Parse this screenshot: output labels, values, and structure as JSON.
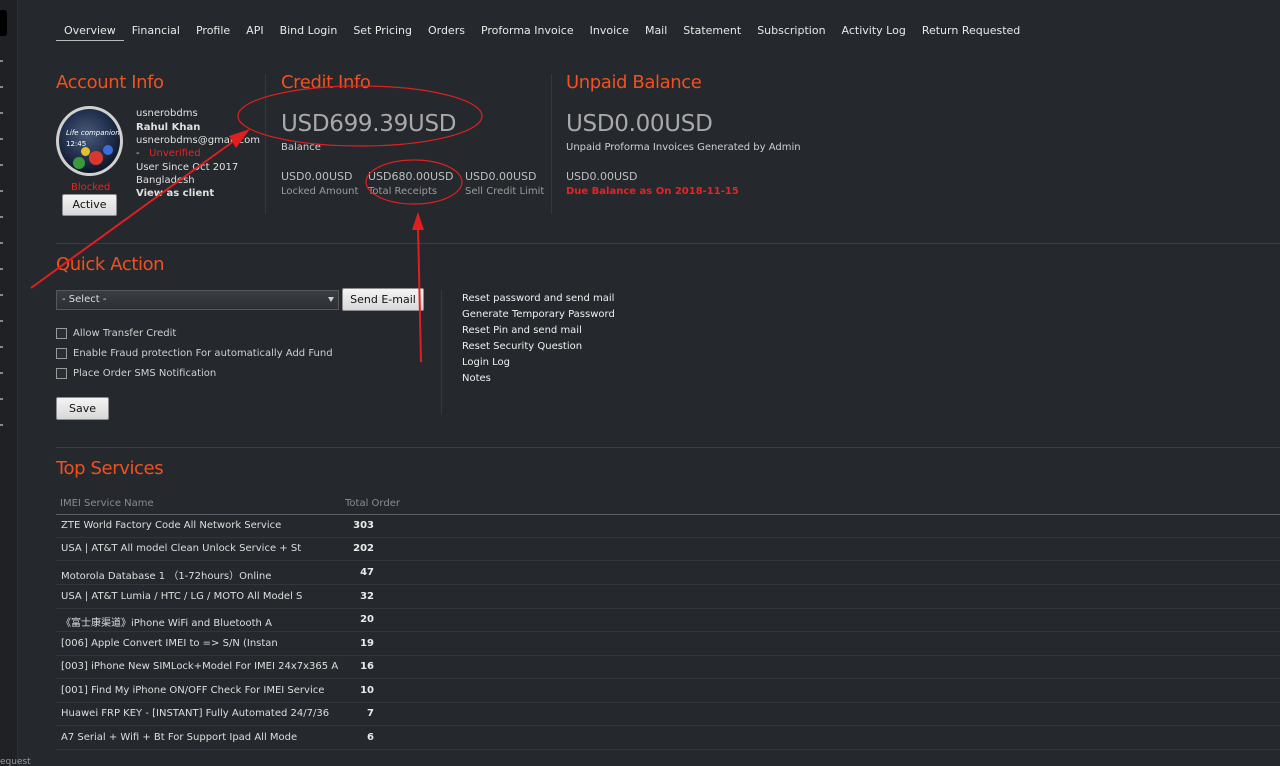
{
  "nav": [
    "Overview",
    "Financial",
    "Profile",
    "API",
    "Bind Login",
    "Set Pricing",
    "Orders",
    "Proforma Invoice",
    "Invoice",
    "Mail",
    "Statement",
    "Subscription",
    "Activity Log",
    "Return Requested"
  ],
  "left_rail": {
    "partial_text": "equest"
  },
  "account": {
    "title": "Account Info",
    "avatar_text_1": "Life companion",
    "avatar_text_2": "12:45",
    "username": "usnerobdms",
    "name": "Rahul Khan",
    "email": "usnerobdms@gmail.com",
    "dash": "-",
    "verify_status": "Unverified",
    "since": "User Since Oct 2017",
    "country": "Bangladesh",
    "view_as": "View as client",
    "blocked_label": "Blocked",
    "active_button": "Active"
  },
  "credit": {
    "title": "Credit Info",
    "balance_amount": "USD699.39USD",
    "balance_label": "Balance",
    "items": [
      {
        "amount": "USD0.00USD",
        "label": "Locked Amount"
      },
      {
        "amount": "USD680.00USD",
        "label": "Total Receipts"
      },
      {
        "amount": "USD0.00USD",
        "label": "Sell Credit Limit"
      }
    ]
  },
  "unpaid": {
    "title": "Unpaid Balance",
    "amount": "USD0.00USD",
    "label": "Unpaid Proforma Invoices Generated by Admin",
    "due_amount": "USD0.00USD",
    "due_label": "Due Balance as On 2018-11-15"
  },
  "quick_action": {
    "title": "Quick Action",
    "select_value": "- Select -",
    "send_button": "Send E-mail",
    "checkboxes": [
      "Allow Transfer Credit",
      "Enable Fraud protection For automatically Add Fund",
      "Place Order SMS Notification"
    ],
    "save_button": "Save",
    "links": [
      "Reset password and send mail",
      "Generate Temporary Password",
      "Reset Pin and send mail",
      "Reset Security Question",
      "Login Log",
      "Notes"
    ]
  },
  "top_services": {
    "title": "Top Services",
    "col_name": "IMEI Service Name",
    "col_total": "Total Order",
    "rows": [
      {
        "name": "ZTE World Factory Code All Network Service",
        "total": "303"
      },
      {
        "name": "USA | AT&T All model Clean Unlock Service + St",
        "total": "202"
      },
      {
        "name": "Motorola Database 1 （1-72hours）Online",
        "total": "47"
      },
      {
        "name": "USA | AT&T Lumia / HTC / LG / MOTO All Model S",
        "total": "32"
      },
      {
        "name": "《富士康渠道》iPhone WiFi and Bluetooth A",
        "total": "20"
      },
      {
        "name": "[006] Apple Convert IMEI to => S/N (Instan",
        "total": "19"
      },
      {
        "name": "[003] iPhone New SIMLock+Model For IMEI 24x7x365 A",
        "total": "16"
      },
      {
        "name": "[001] Find My iPhone ON/OFF Check For IMEI Service",
        "total": "10"
      },
      {
        "name": "Huawei FRP KEY - [INSTANT] Fully Automated 24/7/36",
        "total": "7"
      },
      {
        "name": "A7 Serial + Wifi + Bt For Support Ipad All Mode",
        "total": "6"
      }
    ]
  },
  "colors": {
    "accent": "#f2511f",
    "danger": "#e82323",
    "annotation": "#e02020",
    "background": "#25282d"
  }
}
